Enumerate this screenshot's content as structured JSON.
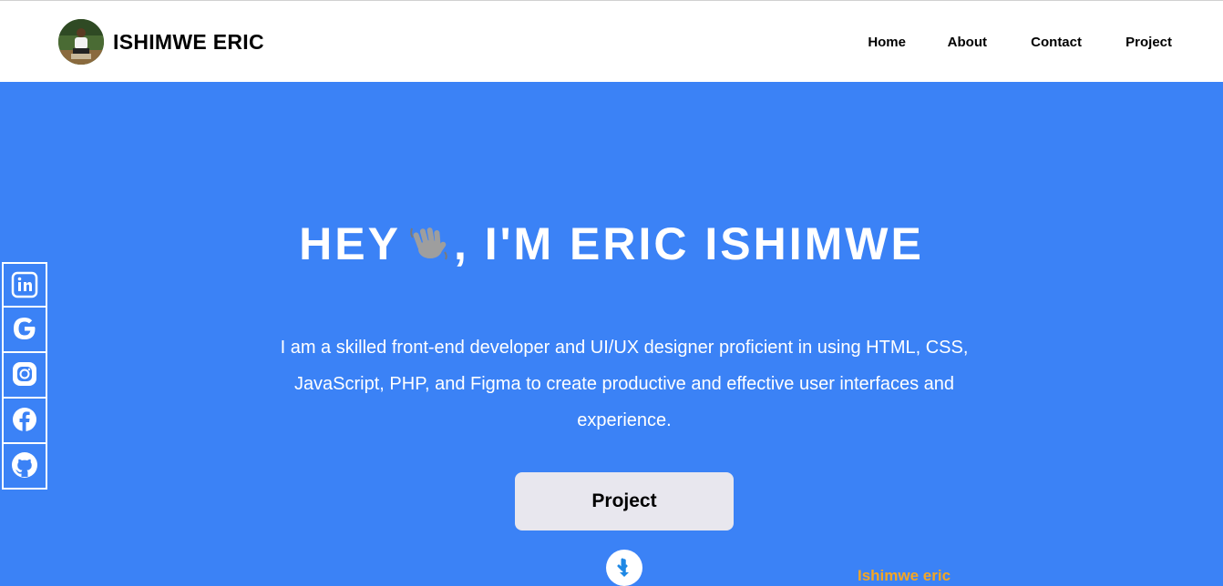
{
  "header": {
    "brand_name": "ISHIMWE ERIC",
    "nav": [
      {
        "label": "Home"
      },
      {
        "label": "About"
      },
      {
        "label": "Contact"
      },
      {
        "label": "Project"
      }
    ]
  },
  "hero": {
    "title_prefix": "HEY",
    "title_suffix": ", I'M ERIC ISHIMWE",
    "wave_icon": "waving-hand-icon",
    "description": "I am a skilled front-end developer and UI/UX designer proficient in using HTML, CSS, JavaScript, PHP, and Figma to create productive and effective user interfaces and experience.",
    "cta_label": "Project",
    "signature": "Ishimwe eric"
  },
  "social": [
    {
      "icon": "linkedin-icon"
    },
    {
      "icon": "google-icon"
    },
    {
      "icon": "instagram-icon"
    },
    {
      "icon": "facebook-icon"
    },
    {
      "icon": "github-icon"
    }
  ],
  "colors": {
    "hero_background": "#3b82f6",
    "button_background": "#e8e7ee",
    "signature": "#f5a623",
    "scroll_arrow": "#1e88e5"
  }
}
